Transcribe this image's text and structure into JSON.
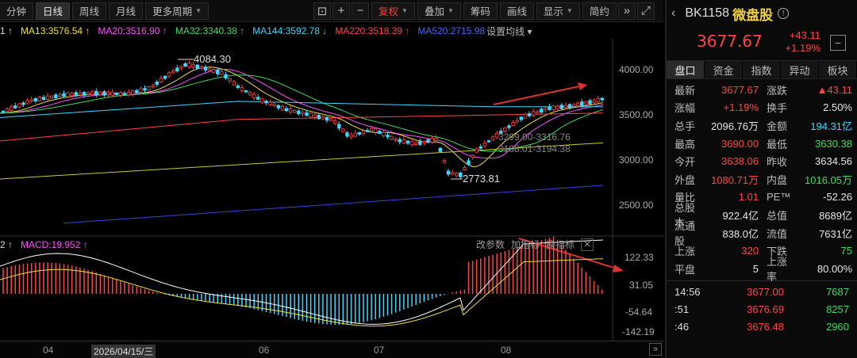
{
  "toolbar": {
    "items": [
      "分钟",
      "日线",
      "周线",
      "月线",
      "更多周期",
      "复权",
      "叠加",
      "筹码",
      "画线",
      "显示",
      "简约"
    ],
    "active": "日线"
  },
  "ma_legend": [
    {
      "label": "1 ↑",
      "color": "#dddddd"
    },
    {
      "label": "MA13:3576.54 ↑",
      "color": "#f0e040"
    },
    {
      "label": "MA20:3516.90 ↑",
      "color": "#ff4dff"
    },
    {
      "label": "MA32:3340.38 ↑",
      "color": "#3ddc5c"
    },
    {
      "label": "MA144:3592.78 ↓",
      "color": "#3fd7ff"
    },
    {
      "label": "MA220:3518.39 ↑",
      "color": "#ff4444"
    },
    {
      "label": "MA520:2715.98",
      "color": "#4466ff"
    },
    {
      "label": "设置均线 ▾",
      "color": "#bbbbbb"
    }
  ],
  "price_axis": [
    "4000.00",
    "3500.00",
    "3000.00",
    "2500.00"
  ],
  "macd_axis": [
    "122.33",
    "31.05",
    "-54.64",
    "-142.19"
  ],
  "annotations": {
    "high": "4084.30",
    "low": "2773.81",
    "range1": "3299.00-3316.76",
    "range2": "3188.01-3194.38"
  },
  "macd": {
    "label_prefix": "2 ↑",
    "label": "MACD:19.952 ↑",
    "tools": [
      "改参数",
      "加指标",
      "换指标"
    ],
    "close": "✕"
  },
  "dates": {
    "items": [
      "04",
      "06",
      "07",
      "08"
    ],
    "selected": "2026/04/15/三"
  },
  "panel": {
    "code": "BK1158",
    "name": "微盘股",
    "price": "3677.67",
    "change": "+43.11",
    "change_pct": "+1.19%",
    "tabs": [
      "盘口",
      "资金",
      "指数",
      "异动",
      "板块"
    ],
    "active_tab": "盘口",
    "quotes": [
      {
        "l": "最新",
        "v": "3677.67",
        "vc": "red",
        "l2": "涨跌",
        "v2": "▲43.11",
        "v2c": "red"
      },
      {
        "l": "涨幅",
        "v": "+1.19%",
        "vc": "red",
        "l2": "换手",
        "v2": "2.50%",
        "v2c": "white"
      },
      {
        "l": "总手",
        "v": "2096.76万",
        "vc": "white",
        "l2": "金额",
        "v2": "194.31亿",
        "v2c": "cyan"
      },
      {
        "l": "最高",
        "v": "3690.00",
        "vc": "red",
        "l2": "最低",
        "v2": "3630.38",
        "v2c": "green"
      },
      {
        "l": "今开",
        "v": "3638.06",
        "vc": "red",
        "l2": "昨收",
        "v2": "3634.56",
        "v2c": "white"
      },
      {
        "l": "外盘",
        "v": "1080.71万",
        "vc": "red",
        "l2": "内盘",
        "v2": "1016.05万",
        "v2c": "green"
      },
      {
        "l": "量比",
        "v": "1.01",
        "vc": "red",
        "l2": "PE™",
        "v2": "-52.26",
        "v2c": "white"
      },
      {
        "l": "总股本",
        "v": "922.4亿",
        "vc": "white",
        "l2": "总值",
        "v2": "8689亿",
        "v2c": "white"
      },
      {
        "l": "流通股",
        "v": "838.0亿",
        "vc": "white",
        "l2": "流值",
        "v2": "7631亿",
        "v2c": "white"
      },
      {
        "l": "上涨",
        "v": "320",
        "vc": "red",
        "l2": "下跌",
        "v2": "75",
        "v2c": "green"
      },
      {
        "l": "平盘",
        "v": "5",
        "vc": "white",
        "l2": "上涨率",
        "v2": "80.00%",
        "v2c": "white"
      }
    ],
    "ticks": [
      {
        "t": "14:56",
        "p": "3677.00",
        "q": "7687"
      },
      {
        "t": ":51",
        "p": "3676.69",
        "q": "8257"
      },
      {
        "t": ":46",
        "p": "3676.48",
        "q": "2960"
      }
    ]
  }
}
